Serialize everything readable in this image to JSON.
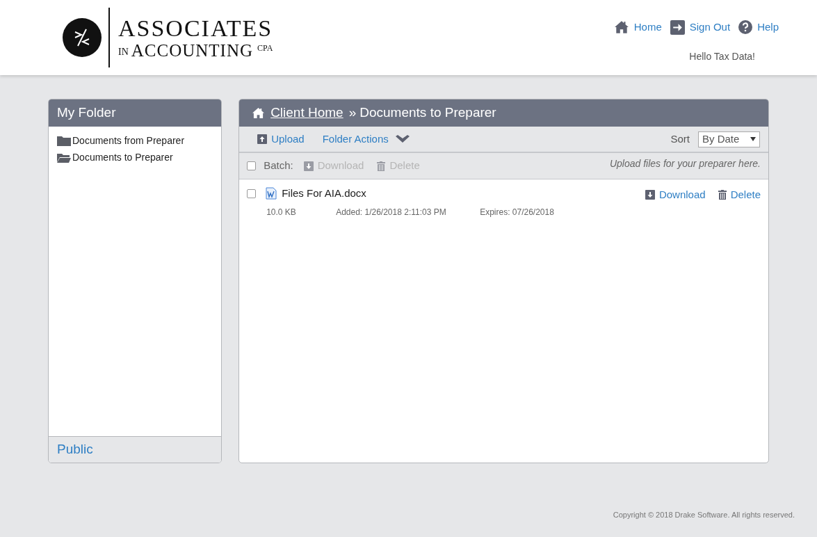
{
  "logo": {
    "line1": "ASSOCIATES",
    "prefix": "IN",
    "line2": "ACCOUNTING",
    "suffix": "CPA"
  },
  "nav": [
    {
      "kind": "home",
      "label": "Home"
    },
    {
      "kind": "signout",
      "label": "Sign Out"
    },
    {
      "kind": "help",
      "label": "Help"
    }
  ],
  "greeting": "Hello Tax Data!",
  "sidebar": {
    "title": "My Folder",
    "items": [
      {
        "kind": "closed",
        "label": "Documents from Preparer"
      },
      {
        "kind": "open",
        "label": "Documents to Preparer"
      }
    ],
    "footer": "Public"
  },
  "main": {
    "breadcrumb": {
      "link": "Client Home",
      "separator": "»",
      "current": "Documents to Preparer"
    },
    "toolbar": {
      "upload": "Upload",
      "folder_actions": "Folder Actions",
      "sort_label": "Sort",
      "sort_value": "By Date"
    },
    "batch": {
      "label": "Batch:",
      "checked": false,
      "disabled": true,
      "download": "Download",
      "delete": "Delete",
      "hint": "Upload files for your preparer here."
    },
    "files": [
      {
        "name": "Files For AIA.docx",
        "checked": false,
        "size": "10.0 KB",
        "added": "Added: 1/26/2018 2:11:03 PM",
        "expires": "Expires: 07/26/2018",
        "download": "Download",
        "delete": "Delete"
      }
    ]
  },
  "footer": "Copyright © 2018 Drake Software. All rights reserved."
}
